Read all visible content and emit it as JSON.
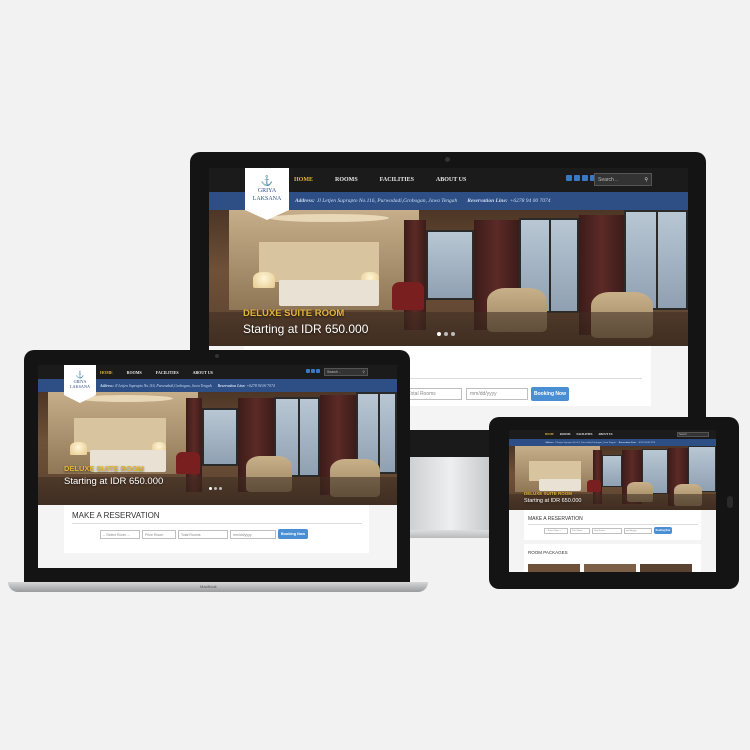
{
  "site": {
    "logo": {
      "line1": "GRIYA",
      "line2": "LAKSANA"
    },
    "nav": [
      "HOME",
      "ROOMS",
      "FACILITIES",
      "ABOUT US"
    ],
    "search_placeholder": "Search ..",
    "address_label": "Address:",
    "address": "Jl Letjen Suprapto No.116, Purwodadi,Grobogan, Jawa Tengah",
    "reservation_label": "Reservation Line:",
    "reservation_phone": "+6278 94 00 7074",
    "hero_title": "DELUXE SUITE ROOM",
    "hero_subtitle": "Starting at IDR 650.000"
  },
  "reservation": {
    "heading": "MAKE A RESERVATION",
    "select_room": "-- Select Room --",
    "price_room": "Price Room",
    "total_rooms": "Total Rooms",
    "date": "mm/dd/yyyy",
    "button": "Booking Now"
  },
  "tablet": {
    "packages_heading": "ROOM PACKAGES"
  },
  "laptop": {
    "brand": "MacBook"
  },
  "colors": {
    "accent": "#e2b33c",
    "bar": "#2d4f86",
    "button": "#4a8fd3"
  }
}
